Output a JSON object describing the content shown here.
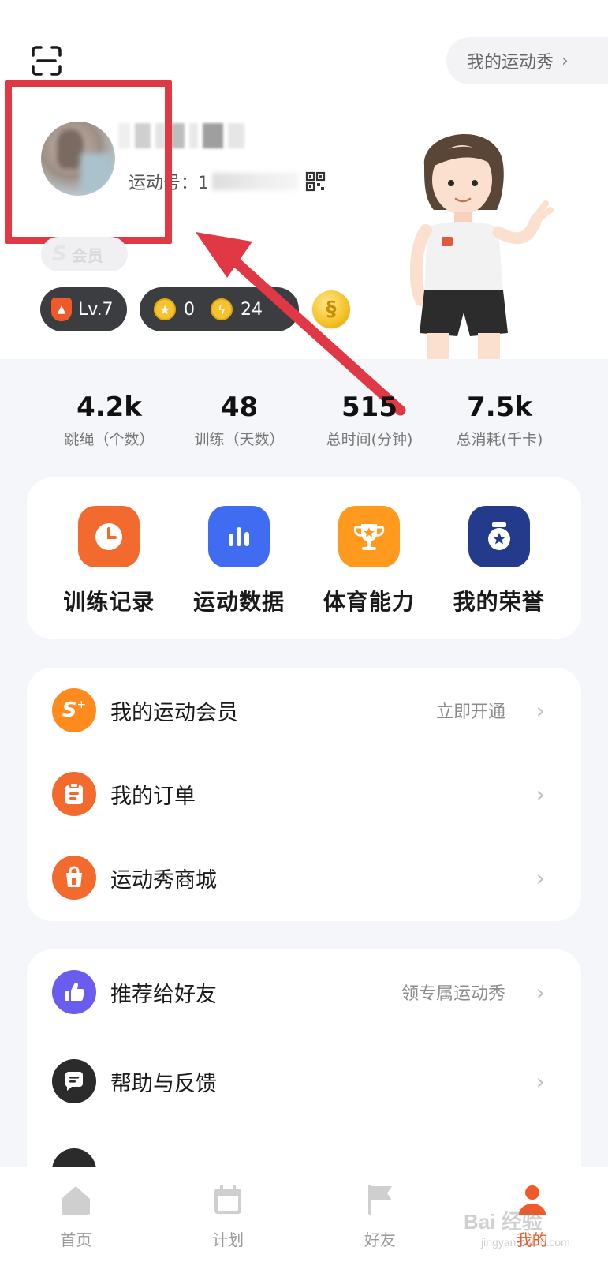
{
  "header": {
    "show_button_label": "我的运动秀",
    "uid_prefix": "运动号：1",
    "vip_label": "会员",
    "vip_mark": "S",
    "level_label": "Lv.7",
    "coins": "0",
    "energy": "24"
  },
  "stats": [
    {
      "value": "4.2k",
      "label": "跳绳（个数）"
    },
    {
      "value": "48",
      "label": "训练（天数）"
    },
    {
      "value": "515",
      "label": "总时间(分钟)"
    },
    {
      "value": "7.5k",
      "label": "总消耗(千卡)"
    }
  ],
  "grid": [
    {
      "label": "训练记录",
      "icon": "clock-icon",
      "color": "#f26a2e"
    },
    {
      "label": "运动数据",
      "icon": "bar-chart-icon",
      "color": "#3f6cf0"
    },
    {
      "label": "体育能力",
      "icon": "trophy-icon",
      "color": "#ff9a1f"
    },
    {
      "label": "我的荣誉",
      "icon": "medal-icon",
      "color": "#243a8a"
    }
  ],
  "list1": [
    {
      "label": "我的运动会员",
      "sub": "立即开通",
      "icon": "vip-s-icon",
      "color": "#ff8a1e"
    },
    {
      "label": "我的订单",
      "sub": "",
      "icon": "order-icon",
      "color": "#f26a2e"
    },
    {
      "label": "运动秀商城",
      "sub": "",
      "icon": "shop-bag-icon",
      "color": "#f26a2e"
    }
  ],
  "list2": [
    {
      "label": "推荐给好友",
      "sub": "领专属运动秀",
      "icon": "thumbs-up-icon",
      "color": "#6b5cf0"
    },
    {
      "label": "帮助与反馈",
      "sub": "",
      "icon": "message-icon",
      "color": "#2b2b2b"
    }
  ],
  "nav": [
    {
      "label": "首页",
      "icon": "home-icon"
    },
    {
      "label": "计划",
      "icon": "calendar-icon"
    },
    {
      "label": "好友",
      "icon": "flag-icon"
    },
    {
      "label": "我的",
      "icon": "user-icon"
    }
  ],
  "watermark": {
    "main": "Bai 经验",
    "sub": "jingyan.baidu.com"
  },
  "colors": {
    "accent": "#f05a28",
    "highlight": "#e03844"
  }
}
